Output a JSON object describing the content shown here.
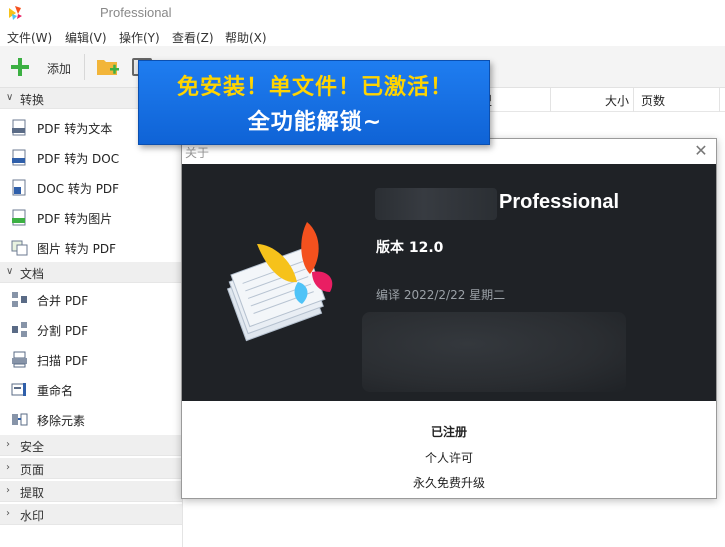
{
  "window": {
    "title": "Professional"
  },
  "menu": {
    "items": [
      "文件(W)",
      "编辑(V)",
      "操作(Y)",
      "查看(Z)",
      "帮助(X)"
    ]
  },
  "toolbar": {
    "add_label": "添加"
  },
  "sidebar": {
    "groups": [
      {
        "label": "转换",
        "expanded": true,
        "items": [
          {
            "label": "PDF 转为文本",
            "icon": "txt-file-icon"
          },
          {
            "label": "PDF 转为 DOC",
            "icon": "doc-file-icon"
          },
          {
            "label": "DOC 转为 PDF",
            "icon": "word-file-icon"
          },
          {
            "label": "PDF 转为图片",
            "icon": "jpg-file-icon"
          },
          {
            "label": "图片 转为 PDF",
            "icon": "image-to-pdf-icon"
          }
        ]
      },
      {
        "label": "文档",
        "expanded": true,
        "items": [
          {
            "label": "合并 PDF",
            "icon": "merge-icon"
          },
          {
            "label": "分割 PDF",
            "icon": "split-icon"
          },
          {
            "label": "扫描 PDF",
            "icon": "scanner-icon"
          },
          {
            "label": "重命名",
            "icon": "rename-icon"
          },
          {
            "label": "移除元素",
            "icon": "remove-elements-icon"
          }
        ]
      },
      {
        "label": "安全",
        "expanded": false
      },
      {
        "label": "页面",
        "expanded": false
      },
      {
        "label": "提取",
        "expanded": false
      },
      {
        "label": "水印",
        "expanded": false
      }
    ]
  },
  "file_list": {
    "columns": {
      "type": "型",
      "size": "大小",
      "pages": "页数"
    }
  },
  "banner": {
    "line1": "免安装！单文件！已激活！",
    "line2": "全功能解锁~"
  },
  "about": {
    "title": "关于",
    "product": "Professional",
    "version": "版本 12.0",
    "build": "编译 2022/2/22 星期二",
    "registration": "已注册",
    "license": "个人许可",
    "upgrade": "永久免费升级"
  },
  "colors": {
    "banner_bg": "#1a73e8",
    "banner_text": "#ffd400",
    "dialog_dark": "#1f2226",
    "accent_green": "#3cb043"
  }
}
